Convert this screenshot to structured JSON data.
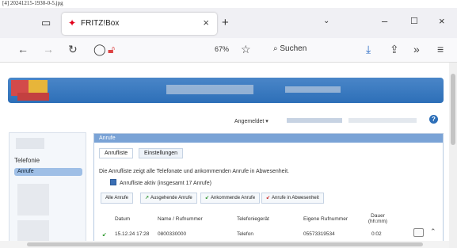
{
  "caption": "[4] 20241215-1930-0-5.jpg",
  "browser": {
    "tab_title": "FRITZ!Box",
    "zoom": "67%",
    "search_label": "Suchen"
  },
  "page": {
    "user_menu": "Angemeldet ▾",
    "help": "?",
    "left_nav": {
      "group": "Telefonie",
      "selected": "Anrufe"
    },
    "panel": {
      "title": "Anrufe",
      "tabs": [
        "Anrufliste",
        "Einstellungen"
      ],
      "description": "Die Anrufliste zeigt alle Telefonate und ankommenden Anrufe in Abwesenheit.",
      "checkbox_label": "Anrufliste aktiv (insgesamt 17 Anrufe)",
      "filters": [
        "Alle Anrufe",
        "Ausgehende Anrufe",
        "Ankommende Anrufe",
        "Anrufe in Abwesenheit"
      ],
      "columns": [
        "Datum",
        "Name / Rufnummer",
        "Telefoniegerät",
        "Eigene Rufnummer",
        "Dauer (hh:mm)"
      ],
      "rows": [
        {
          "date": "15.12.24 17:28",
          "name": "0800330000",
          "device": "Telefon",
          "own": "05573319534",
          "duration": "0:02"
        }
      ]
    }
  }
}
